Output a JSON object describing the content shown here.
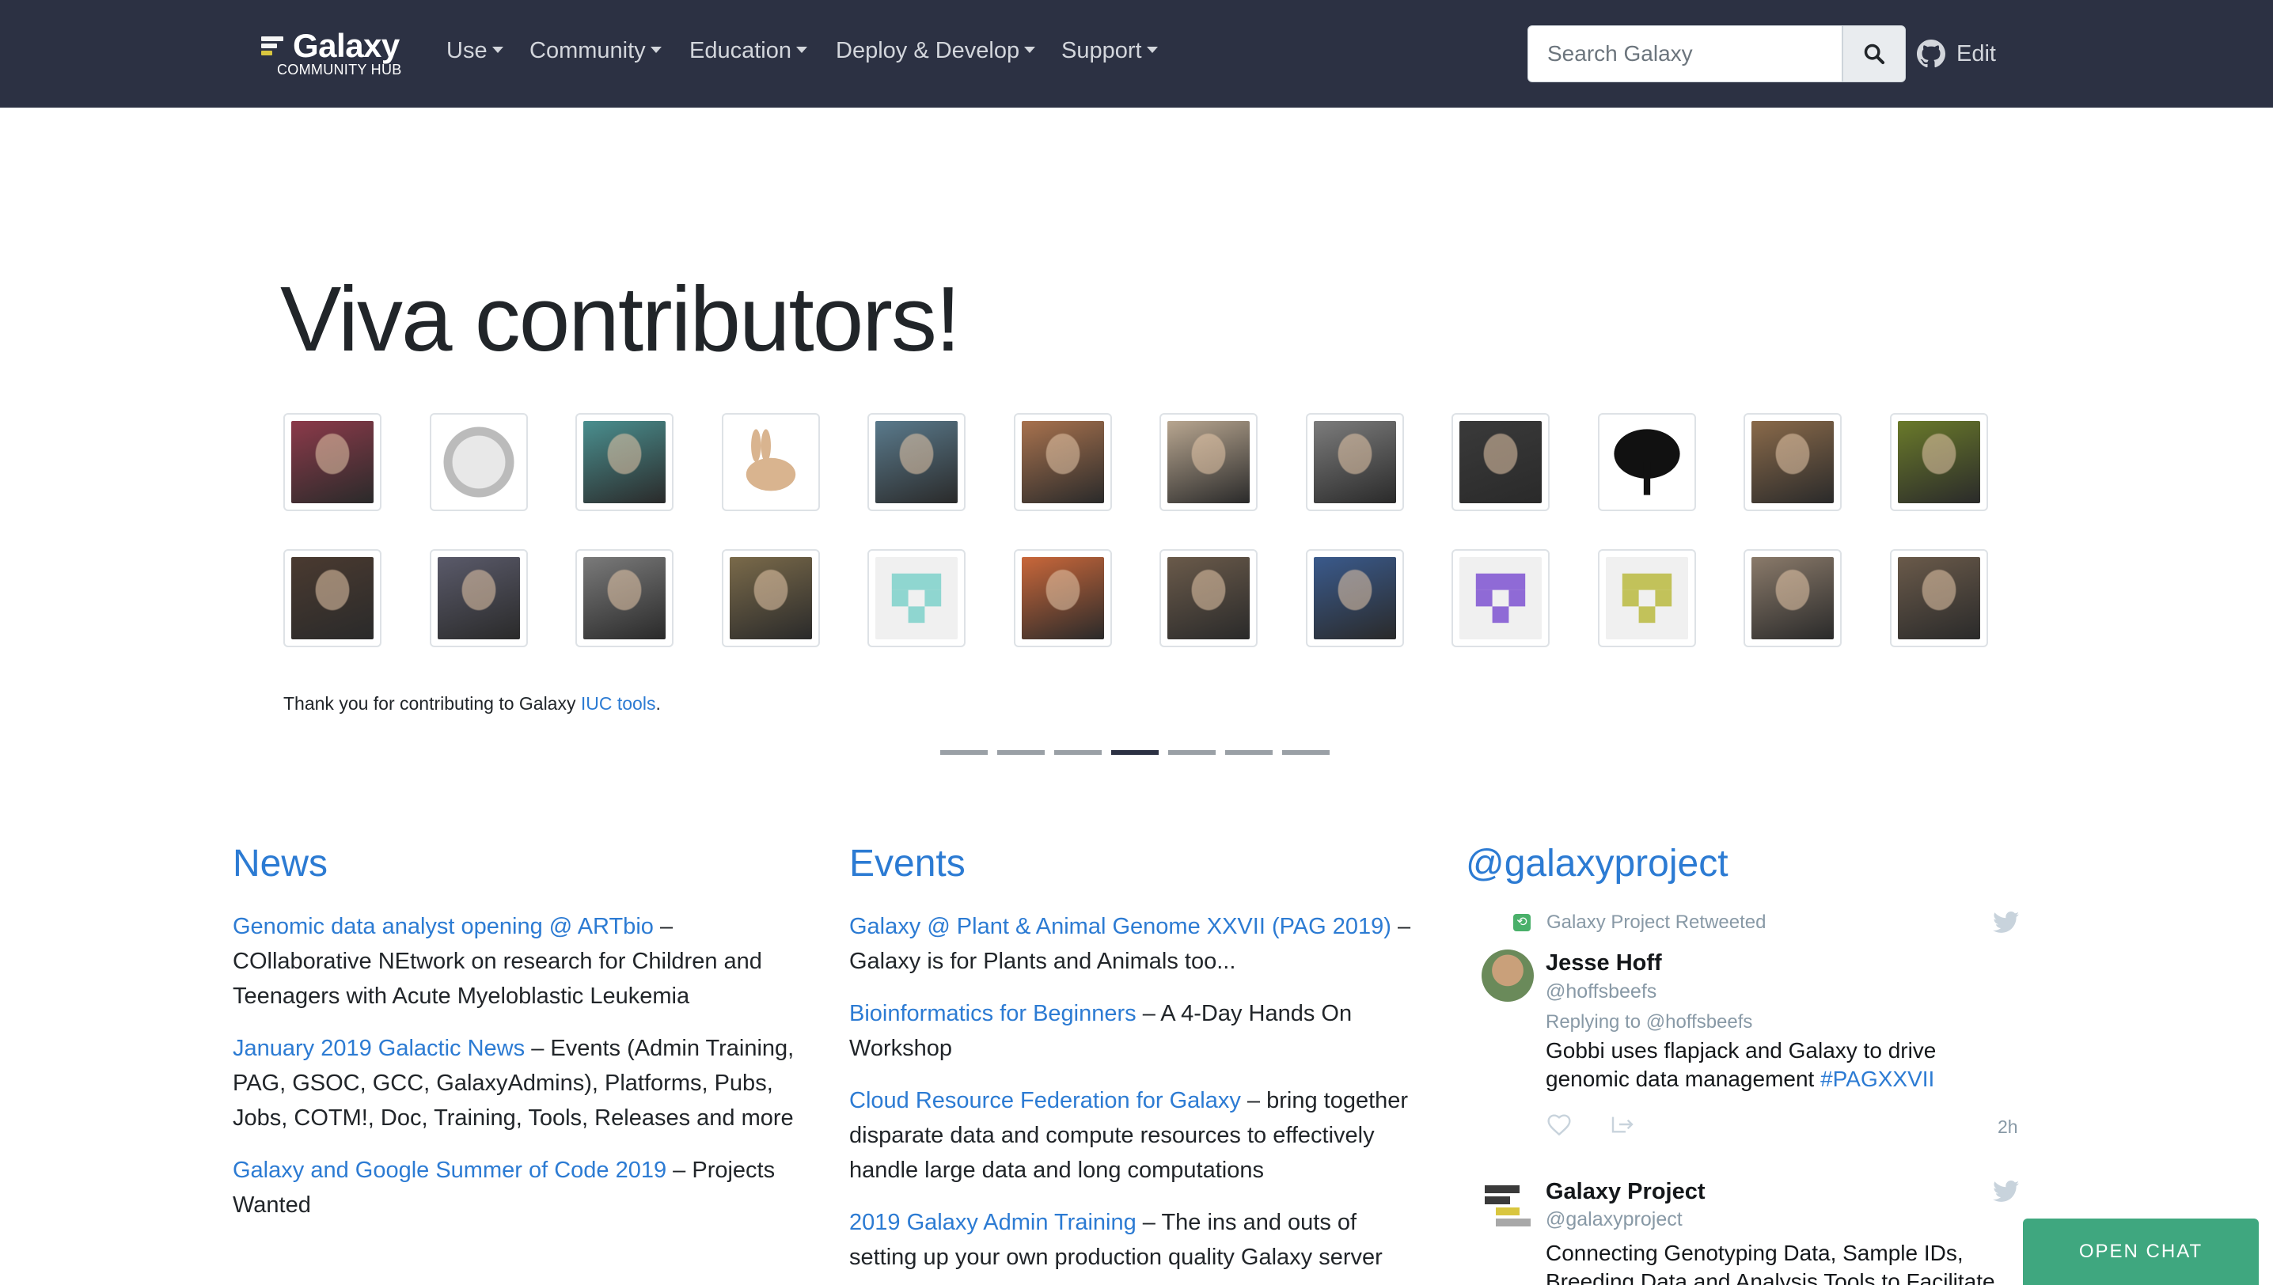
{
  "brand": {
    "title": "Galaxy",
    "subtitle": "COMMUNITY HUB",
    "colors": [
      "#f5f5f5",
      "#d9c63f",
      "#a8a8a8"
    ]
  },
  "nav": {
    "items": [
      "Use",
      "Community",
      "Education",
      "Deploy & Develop",
      "Support"
    ],
    "search_placeholder": "Search Galaxy",
    "search_icon": "search-icon",
    "edit_label": "Edit",
    "edit_icon": "github-icon"
  },
  "hero": {
    "title": "Viva contributors!",
    "thanks_prefix": "Thank you for contributing to Galaxy ",
    "thanks_link": "IUC tools",
    "thanks_suffix": ".",
    "slide_count": 7,
    "active_slide": 4,
    "avatars_row1": [
      {
        "name": "contributor-flower",
        "color": "#8c3a4a"
      },
      {
        "name": "contributor-sketch",
        "color": "#c9c9c9"
      },
      {
        "name": "contributor-portrait",
        "color": "#4a8f8f"
      },
      {
        "name": "contributor-rabbit",
        "color": "#d9b48f"
      },
      {
        "name": "contributor-boat",
        "color": "#5a7a8c"
      },
      {
        "name": "contributor-woman",
        "color": "#a8724e"
      },
      {
        "name": "contributor-man",
        "color": "#b8a690"
      },
      {
        "name": "contributor-cat",
        "color": "#7c7c7c"
      },
      {
        "name": "contributor-bw",
        "color": "#3a3a3a"
      },
      {
        "name": "contributor-tree",
        "color": "#111111"
      },
      {
        "name": "contributor-glasses",
        "color": "#8a6a4a"
      },
      {
        "name": "contributor-toy",
        "color": "#6a7a2a"
      }
    ],
    "avatars_row2": [
      {
        "name": "contributor-dark",
        "color": "#4a3a30"
      },
      {
        "name": "contributor-chalkboard",
        "color": "#5a5a6a"
      },
      {
        "name": "contributor-office",
        "color": "#7a7a7a"
      },
      {
        "name": "contributor-older",
        "color": "#7a6a4a"
      },
      {
        "name": "contributor-identicon-teal",
        "color": "#8fd6d0"
      },
      {
        "name": "contributor-cartoon",
        "color": "#c9673a"
      },
      {
        "name": "contributor-smile",
        "color": "#6a5a4a"
      },
      {
        "name": "contributor-boat2",
        "color": "#3a5a8c"
      },
      {
        "name": "contributor-identicon-purple",
        "color": "#8f6ad6"
      },
      {
        "name": "contributor-identicon-olive",
        "color": "#c2c25a"
      },
      {
        "name": "contributor-beard",
        "color": "#8a7a6a"
      },
      {
        "name": "contributor-outdoor",
        "color": "#6a5a4a"
      }
    ]
  },
  "news": {
    "title": "News",
    "items": [
      {
        "link": "Genomic data analyst opening @ ARTbio",
        "text": " – COllaborative NEtwork on research for Children and Teenagers with Acute Myeloblastic Leukemia"
      },
      {
        "link": "January 2019 Galactic News",
        "text": " – Events (Admin Training, PAG, GSOC, GCC, GalaxyAdmins), Platforms, Pubs, Jobs, COTM!, Doc, Training, Tools, Releases and more"
      },
      {
        "link": "Galaxy and Google Summer of Code 2019",
        "text": " – Projects Wanted"
      }
    ]
  },
  "events": {
    "title": "Events",
    "items": [
      {
        "link": "Galaxy @ Plant & Animal Genome XXVII (PAG 2019)",
        "text": " – Galaxy is for Plants and Animals too..."
      },
      {
        "link": "Bioinformatics for Beginners",
        "text": " – A 4-Day Hands On Workshop"
      },
      {
        "link": "Cloud Resource Federation for Galaxy",
        "text": " – bring together disparate data and compute resources to effectively handle large data and long computations"
      },
      {
        "link": "2019 Galaxy Admin Training",
        "text": " – The ins and outs of setting up your own production quality Galaxy server"
      }
    ]
  },
  "twitter": {
    "title": "@galaxyproject",
    "retweet_label": "Galaxy Project Retweeted",
    "tweet1": {
      "name": "Jesse Hoff",
      "handle": "@hoffsbeefs",
      "reply": "Replying to @hoffsbeefs",
      "text": "Gobbi uses flapjack and Galaxy to drive genomic data management ",
      "hashtag": "#PAGXXVII",
      "time": "2h"
    },
    "tweet2": {
      "name": "Galaxy Project",
      "handle": "@galaxyproject",
      "text": "Connecting Genotyping Data, Sample IDs, Breeding Data and Analysis Tools to Facilitate"
    }
  },
  "chat": {
    "label": "OPEN CHAT"
  },
  "colors": {
    "navbar": "#2c3143",
    "link": "#2c7bd3",
    "chat": "#3fa77f",
    "twitter_blue": "#1da1f2"
  }
}
